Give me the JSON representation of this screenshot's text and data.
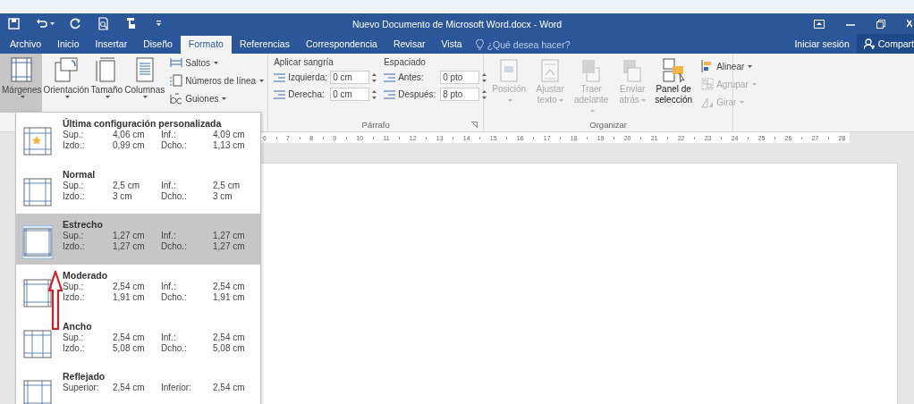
{
  "window": {
    "title": "Nuevo Documento de Microsoft Word.docx - Word"
  },
  "quick_access": [
    {
      "kind": "save",
      "dropdown": false
    },
    {
      "kind": "undo",
      "dropdown": true
    },
    {
      "kind": "redo",
      "dropdown": false
    },
    {
      "kind": "preview",
      "dropdown": false
    },
    {
      "kind": "touch",
      "dropdown": false
    },
    {
      "kind": "customize",
      "dropdown": false
    }
  ],
  "tabs": [
    {
      "label": "Archivo",
      "selected": false
    },
    {
      "label": "Inicio",
      "selected": false
    },
    {
      "label": "Insertar",
      "selected": false
    },
    {
      "label": "Diseño",
      "selected": false
    },
    {
      "label": "Formato",
      "selected": true
    },
    {
      "label": "Referencias",
      "selected": false
    },
    {
      "label": "Correspondencia",
      "selected": false
    },
    {
      "label": "Revisar",
      "selected": false
    },
    {
      "label": "Vista",
      "selected": false
    }
  ],
  "tell_me": {
    "placeholder": "¿Qué desea hacer?"
  },
  "account": {
    "sign_in": "Iniciar sesión",
    "share": "Compart"
  },
  "page_setup": {
    "buttons": [
      {
        "label": "Márgenes",
        "kind": "margins",
        "selected": true
      },
      {
        "label": "Orientación",
        "kind": "orientation",
        "selected": false
      },
      {
        "label": "Tamaño",
        "kind": "size",
        "selected": false
      },
      {
        "label": "Columnas",
        "kind": "columns",
        "selected": false
      }
    ],
    "commands": [
      {
        "label": "Saltos",
        "kind": "breaks"
      },
      {
        "label": "Números de línea",
        "kind": "line_numbers"
      },
      {
        "label": "Guiones",
        "kind": "hyphenation"
      }
    ]
  },
  "paragraph": {
    "title": "Párrafo",
    "indent_heading": "Aplicar sangría",
    "spacing_heading": "Espaciado",
    "indent": [
      {
        "label": "Izquierda:",
        "value": "0 cm"
      },
      {
        "label": "Derecha:",
        "value": "0 cm"
      }
    ],
    "spacing": [
      {
        "label": "Antes:",
        "value": "0 pto"
      },
      {
        "label": "Después:",
        "value": "8 pto"
      }
    ]
  },
  "arrange": {
    "title": "Organizar",
    "buttons": [
      {
        "label": "Posición",
        "kind": "position",
        "disabled": true
      },
      {
        "label": "Ajustar texto",
        "kind": "wrap",
        "disabled": true
      },
      {
        "label": "Traer adelante",
        "kind": "forward",
        "disabled": true
      },
      {
        "label": "Enviar atrás",
        "kind": "backward",
        "disabled": true
      },
      {
        "label": "Panel de selección",
        "kind": "pane",
        "disabled": false
      }
    ],
    "commands": [
      {
        "label": "Alinear",
        "kind": "align",
        "disabled": false
      },
      {
        "label": "Agrupar",
        "kind": "group",
        "disabled": true
      },
      {
        "label": "Girar",
        "kind": "rotate",
        "disabled": true
      }
    ]
  },
  "ruler": {
    "labels": [
      "6",
      "7",
      "8",
      "9",
      "10",
      "11",
      "12",
      "13",
      "14",
      "15",
      "16",
      "17",
      "18",
      "19",
      "20",
      "21",
      "22",
      "23",
      "24",
      "25",
      "26",
      "27",
      "28"
    ]
  },
  "margins_menu": {
    "items": [
      {
        "name": "Última configuración personalizada",
        "kind": "custom",
        "selected": false,
        "rows": [
          [
            "Sup.:",
            "4,06 cm",
            "Inf.:",
            "4,09 cm"
          ],
          [
            "Izdo.:",
            "0,99 cm",
            "Dcho.:",
            "1,13 cm"
          ]
        ]
      },
      {
        "name": "Normal",
        "kind": "normal",
        "selected": false,
        "rows": [
          [
            "Sup.:",
            "2,5 cm",
            "Inf.:",
            "2,5 cm"
          ],
          [
            "Izdo.:",
            "3 cm",
            "Dcho.:",
            "3 cm"
          ]
        ]
      },
      {
        "name": "Estrecho",
        "kind": "narrow",
        "selected": true,
        "rows": [
          [
            "Sup.:",
            "1,27 cm",
            "Inf.:",
            "1,27 cm"
          ],
          [
            "Izdo.:",
            "1,27 cm",
            "Dcho.:",
            "1,27 cm"
          ]
        ]
      },
      {
        "name": "Moderado",
        "kind": "moderate",
        "selected": false,
        "rows": [
          [
            "Sup.:",
            "2,54 cm",
            "Inf.:",
            "2,54 cm"
          ],
          [
            "Izdo.:",
            "1,91 cm",
            "Dcho.:",
            "1,91 cm"
          ]
        ]
      },
      {
        "name": "Ancho",
        "kind": "wide",
        "selected": false,
        "rows": [
          [
            "Sup.:",
            "2,54 cm",
            "Inf.:",
            "2,54 cm"
          ],
          [
            "Izdo.:",
            "5,08 cm",
            "Dcho.:",
            "5,08 cm"
          ]
        ]
      },
      {
        "name": "Reflejado",
        "kind": "mirrored",
        "selected": false,
        "rows": [
          [
            "Superior:",
            "2,54 cm",
            "Inferior:",
            "2,54 cm"
          ]
        ]
      }
    ]
  }
}
